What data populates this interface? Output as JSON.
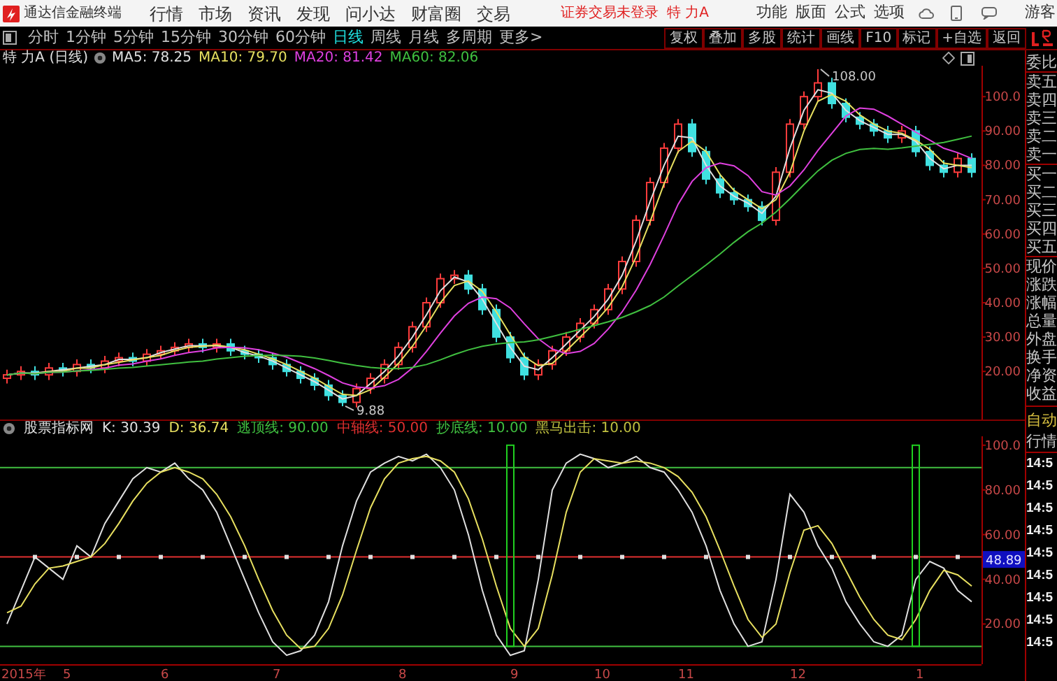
{
  "title_bar": {
    "app_name": "通达信金融终端",
    "menu": [
      "行情",
      "市场",
      "资讯",
      "发现",
      "问小达",
      "财富圈",
      "交易"
    ],
    "status": "证券交易未登录",
    "stock": "特 力A",
    "tools": [
      "功能",
      "版面",
      "公式",
      "选项"
    ],
    "user": "游客"
  },
  "period_tabs": [
    {
      "label": "分时",
      "selected": false
    },
    {
      "label": "1分钟",
      "selected": false
    },
    {
      "label": "5分钟",
      "selected": false
    },
    {
      "label": "15分钟",
      "selected": false
    },
    {
      "label": "30分钟",
      "selected": false
    },
    {
      "label": "60分钟",
      "selected": false
    },
    {
      "label": "日线",
      "selected": true
    },
    {
      "label": "周线",
      "selected": false
    },
    {
      "label": "月线",
      "selected": false
    },
    {
      "label": "多周期",
      "selected": false
    },
    {
      "label": "更多>",
      "selected": false
    }
  ],
  "toolbar_buttons": [
    "复权",
    "叠加",
    "多股",
    "统计",
    "画线",
    "F10",
    "标记",
    "+自选",
    "返回"
  ],
  "legend": {
    "stock": "特 力A (日线)",
    "ma": [
      {
        "label": "MA5: 78.25",
        "color": "#e0e0e0"
      },
      {
        "label": "MA10: 79.70",
        "color": "#e8e060"
      },
      {
        "label": "MA20: 81.42",
        "color": "#e040e0"
      },
      {
        "label": "MA60: 82.06",
        "color": "#40c040"
      }
    ]
  },
  "main_chart": {
    "price_axis": [
      "100.0",
      "90.00",
      "80.00",
      "70.00",
      "60.00",
      "50.00",
      "40.00",
      "30.00",
      "20.00"
    ],
    "high_label": "108.00",
    "low_label": "9.88"
  },
  "indicator": {
    "name": "股票指标网",
    "values": [
      {
        "label": "K: 30.39",
        "color": "#e0e0e0"
      },
      {
        "label": "D: 36.74",
        "color": "#e8e060"
      },
      {
        "label": "逃顶线: 90.00",
        "color": "#40c040"
      },
      {
        "label": "中轴线: 50.00",
        "color": "#e03030"
      },
      {
        "label": "抄底线: 10.00",
        "color": "#40c040"
      },
      {
        "label": "黑马出击: 10.00",
        "color": "#c0c040"
      }
    ],
    "axis": [
      "100.0",
      "80.00",
      "60.00",
      "40.00",
      "20.00"
    ],
    "current_value": "48.89"
  },
  "date_axis": [
    "2015年",
    "5",
    "6",
    "7",
    "8",
    "9",
    "10",
    "11",
    "12",
    "1"
  ],
  "quote_panel": {
    "labels": [
      "委比",
      "卖五",
      "卖四",
      "卖三",
      "卖二",
      "卖一",
      "买一",
      "买二",
      "买三",
      "买四",
      "买五",
      "现价",
      "涨跌",
      "涨幅",
      "总量",
      "外盘",
      "换手",
      "净资",
      "收益"
    ],
    "mode": "自动",
    "mode_label": "行情",
    "times": [
      "14:5",
      "14:5",
      "14:5",
      "14:5",
      "14:5",
      "14:5",
      "14:5",
      "14:5",
      "14:5"
    ]
  }
}
